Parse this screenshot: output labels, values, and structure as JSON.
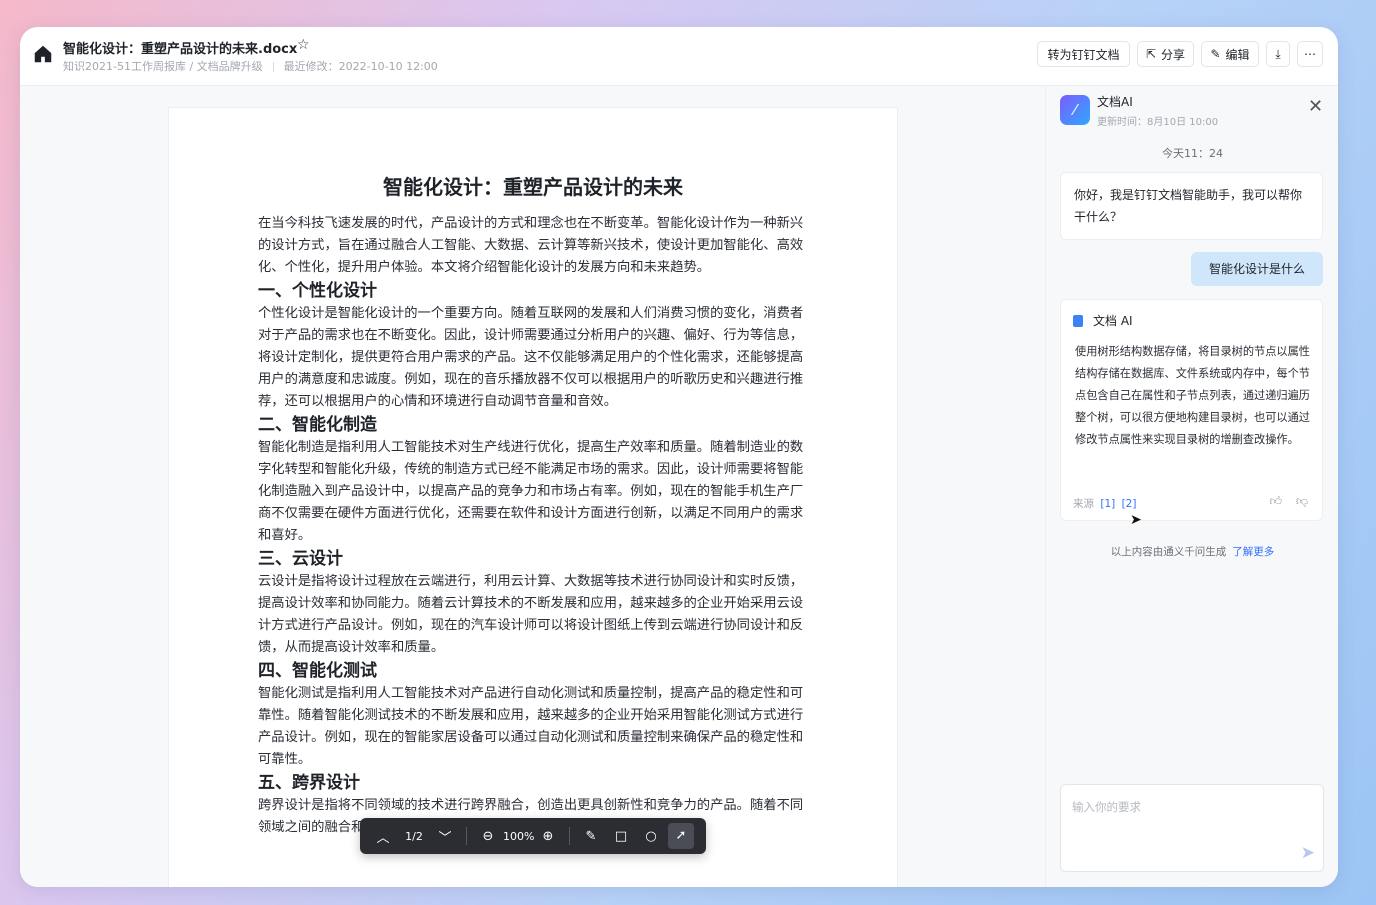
{
  "header": {
    "title": "智能化设计：重塑产品设计的未来.docx",
    "path": "知识2021-51工作周报库 / 文档品牌升级",
    "modified": "最近修改：2022-10-10 12:00",
    "buttons": {
      "convert": "转为钉钉文档",
      "share": "分享",
      "edit": "编辑"
    }
  },
  "document": {
    "title": "智能化设计：重塑产品设计的未来",
    "intro": "在当今科技飞速发展的时代，产品设计的方式和理念也在不断变革。智能化设计作为一种新兴的设计方式，旨在通过融合人工智能、大数据、云计算等新兴技术，使设计更加智能化、高效化、个性化，提升用户体验。本文将介绍智能化设计的发展方向和未来趋势。",
    "sections": [
      {
        "heading": "一、个性化设计",
        "text": "个性化设计是智能化设计的一个重要方向。随着互联网的发展和人们消费习惯的变化，消费者对于产品的需求也在不断变化。因此，设计师需要通过分析用户的兴趣、偏好、行为等信息，将设计定制化，提供更符合用户需求的产品。这不仅能够满足用户的个性化需求，还能够提高用户的满意度和忠诚度。例如，现在的音乐播放器不仅可以根据用户的听歌历史和兴趣进行推荐，还可以根据用户的心情和环境进行自动调节音量和音效。"
      },
      {
        "heading": "二、智能化制造",
        "text": "智能化制造是指利用人工智能技术对生产线进行优化，提高生产效率和质量。随着制造业的数字化转型和智能化升级，传统的制造方式已经不能满足市场的需求。因此，设计师需要将智能化制造融入到产品设计中，以提高产品的竞争力和市场占有率。例如，现在的智能手机生产厂商不仅需要在硬件方面进行优化，还需要在软件和设计方面进行创新，以满足不同用户的需求和喜好。"
      },
      {
        "heading": "三、云设计",
        "text": "云设计是指将设计过程放在云端进行，利用云计算、大数据等技术进行协同设计和实时反馈，提高设计效率和协同能力。随着云计算技术的不断发展和应用，越来越多的企业开始采用云设计方式进行产品设计。例如，现在的汽车设计师可以将设计图纸上传到云端进行协同设计和反馈，从而提高设计效率和质量。"
      },
      {
        "heading": "四、智能化测试",
        "text": "智能化测试是指利用人工智能技术对产品进行自动化测试和质量控制，提高产品的稳定性和可靠性。随着智能化测试技术的不断发展和应用，越来越多的企业开始采用智能化测试方式进行产品设计。例如，现在的智能家居设备可以通过自动化测试和质量控制来确保产品的稳定性和可靠性。"
      },
      {
        "heading": "五、跨界设计",
        "text": "跨界设计是指将不同领域的技术进行跨界融合，创造出更具创新性和竞争力的产品。随着不同领域之间的融合和交叉，设计师需要将不同领域的技术进行跨界融合，以创"
      }
    ]
  },
  "viewer_toolbar": {
    "page": "1/2",
    "zoom": "100%"
  },
  "ai_panel": {
    "name": "文档AI",
    "updated": "更新时间：8月10日 10:00",
    "today": "今天11：24",
    "greeting": "你好，我是钉钉文档智能助手，我可以帮你干什么？",
    "user_question": "智能化设计是什么",
    "answer_title": "文档 AI",
    "answer_text": "使用树形结构数据存储，将目录树的节点以属性结构存储在数据库、文件系统或内存中，每个节点包含自己在属性和子节点列表，通过递归遍历整个树，可以很方便地构建目录树，也可以通过修改节点属性来实现目录树的增删查改操作。",
    "source_label": "来源",
    "sources": [
      "[1]",
      "[2]"
    ],
    "generated_note": "以上内容由通义千问生成",
    "learn_more": "了解更多",
    "input_placeholder": "输入你的要求"
  },
  "colors": {
    "accent": "#3370ff",
    "user_bubble": "#cfe6fb",
    "toolbar_bg": "#2b2d33"
  }
}
